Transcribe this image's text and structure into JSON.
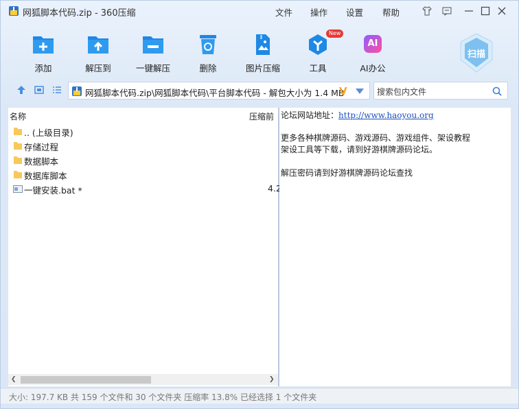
{
  "window": {
    "title": "网狐脚本代码.zip - 360压缩"
  },
  "menu": [
    "文件",
    "操作",
    "设置",
    "帮助"
  ],
  "toolbar": {
    "items": [
      "添加",
      "解压到",
      "一键解压",
      "删除",
      "图片压缩",
      "工具",
      "AI办公"
    ],
    "tool_badge": "New",
    "ai_icon_text": "AI",
    "scan_label": "扫描"
  },
  "address": {
    "path": "网狐脚本代码.zip\\网狐脚本代码\\平台脚本代码 - 解包大小为 1.4 MB",
    "vip_badge": "V"
  },
  "search": {
    "placeholder": "搜索包内文件"
  },
  "filelist": {
    "headers": {
      "name": "名称",
      "size": "压缩前"
    },
    "rows": [
      {
        "name": ".. (上级目录)",
        "size": "",
        "type": "folder"
      },
      {
        "name": "存储过程",
        "size": "",
        "type": "folder"
      },
      {
        "name": "数据脚本",
        "size": "",
        "type": "folder"
      },
      {
        "name": "数据库脚本",
        "size": "",
        "type": "folder"
      },
      {
        "name": "一键安装.bat *",
        "size": "4.2",
        "type": "bat"
      }
    ]
  },
  "comment": {
    "line1_label": "论坛网站地址：",
    "line1_link": "http://www.haoyou.org",
    "line2": "更多各种棋牌源码、游戏源码、游戏组件、架设教程",
    "line3": "架设工具等下载，请到好游棋牌源码论坛。",
    "line4": "解压密码请到好游棋牌源码论坛查找"
  },
  "status": {
    "text": "大小: 197.7 KB 共 159 个文件和 30 个文件夹 压缩率 13.8% 已经选择 1 个文件夹"
  },
  "colors": {
    "accent": "#1e88e5",
    "badge": "#e53935",
    "vip": "#f5a623"
  }
}
